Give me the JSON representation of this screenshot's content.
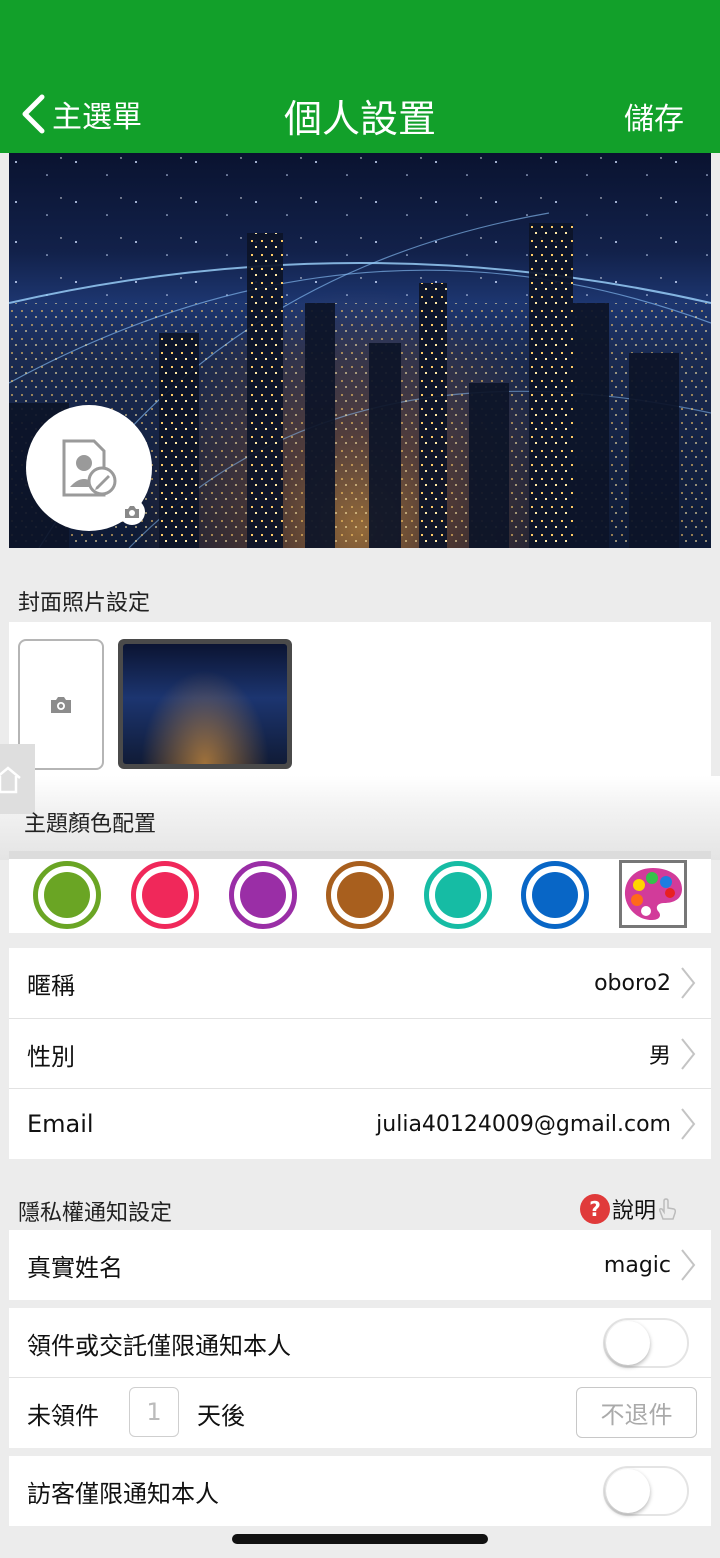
{
  "header": {
    "back_label": "主選單",
    "title": "個人設置",
    "save_label": "儲存",
    "color": "#12a02a"
  },
  "cover_section": {
    "label": "封面照片設定"
  },
  "theme_section": {
    "label": "主題顏色配置",
    "colors": [
      "#6aa524",
      "#f0285a",
      "#9a2ea6",
      "#a85f1e",
      "#16bca4",
      "#0866c6"
    ]
  },
  "profile": {
    "nickname_label": "暱稱",
    "nickname_value": "oboro2",
    "gender_label": "性別",
    "gender_value": "男",
    "email_label": "Email",
    "email_value": "julia40124009@gmail.com"
  },
  "privacy": {
    "label": "隱私權通知設定",
    "help_label": "說明",
    "realname_label": "真實姓名",
    "realname_value": "magic",
    "pickup_notify_label": "領件或交託僅限通知本人",
    "pickup_notify_on": false,
    "unclaimed_label": "未領件",
    "unclaimed_days": "1",
    "days_after_label": "天後",
    "no_return_label": "不退件",
    "visitor_notify_label": "訪客僅限通知本人",
    "visitor_notify_on": false
  }
}
